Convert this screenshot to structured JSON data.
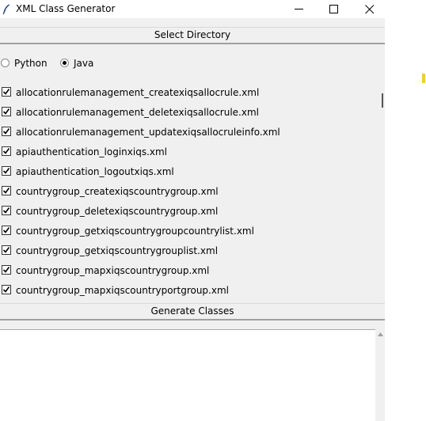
{
  "window": {
    "title": "XML Class Generator"
  },
  "buttons": {
    "select_directory": "Select Directory",
    "generate_classes": "Generate Classes"
  },
  "language": {
    "options": [
      "Python",
      "Java"
    ],
    "selected": "Java"
  },
  "files": [
    {
      "name": "allocationrulemanagement_createxiqsallocrule.xml",
      "checked": true
    },
    {
      "name": "allocationrulemanagement_deletexiqsallocrule.xml",
      "checked": true
    },
    {
      "name": "allocationrulemanagement_updatexiqsallocruleinfo.xml",
      "checked": true
    },
    {
      "name": "apiauthentication_loginxiqs.xml",
      "checked": true
    },
    {
      "name": "apiauthentication_logoutxiqs.xml",
      "checked": true
    },
    {
      "name": "countrygroup_createxiqscountrygroup.xml",
      "checked": true
    },
    {
      "name": "countrygroup_deletexiqscountrygroup.xml",
      "checked": true
    },
    {
      "name": "countrygroup_getxiqscountrygroupcountrylist.xml",
      "checked": true
    },
    {
      "name": "countrygroup_getxiqscountrygrouplist.xml",
      "checked": true
    },
    {
      "name": "countrygroup_mapxiqscountrygroup.xml",
      "checked": true
    },
    {
      "name": "countrygroup_mapxiqscountryportgroup.xml",
      "checked": true
    }
  ],
  "output": {
    "text": ""
  },
  "colors": {
    "window_bg": "#f0f0f0",
    "accent_mark": "#f5d400"
  }
}
